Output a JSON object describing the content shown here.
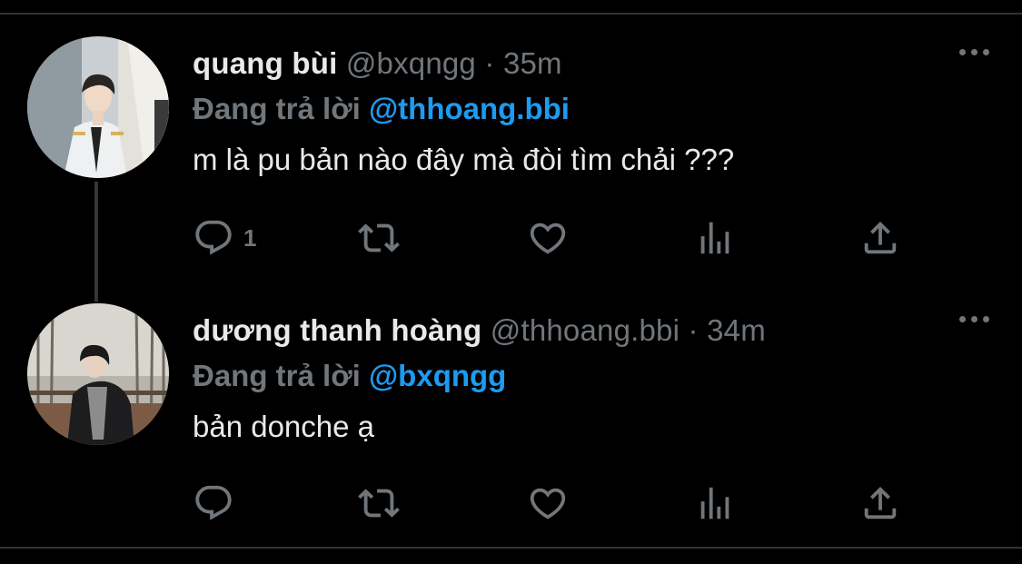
{
  "tweets": [
    {
      "name": "quang bùi",
      "handle": "@bxqngg",
      "separator": "·",
      "time": "35m",
      "reply_prefix": "Đang trả lời",
      "reply_to": "@thhoang.bbi",
      "text": "m là pu bản nào đây mà đòi tìm chải ???",
      "reply_count": "1"
    },
    {
      "name": "dương thanh hoàng",
      "handle": "@thhoang.bbi",
      "separator": "·",
      "time": "34m",
      "reply_prefix": "Đang trả lời",
      "reply_to": "@bxqngg",
      "text": "bản donche ạ",
      "reply_count": ""
    }
  ],
  "icons": {
    "reply": "reply-icon",
    "retweet": "retweet-icon",
    "like": "heart-icon",
    "views": "views-icon",
    "share": "share-icon",
    "more": "more-icon"
  },
  "colors": {
    "background": "#000000",
    "text": "#e7e9ea",
    "muted": "#71767b",
    "accent": "#1d9bf0",
    "border": "#2f3336"
  }
}
